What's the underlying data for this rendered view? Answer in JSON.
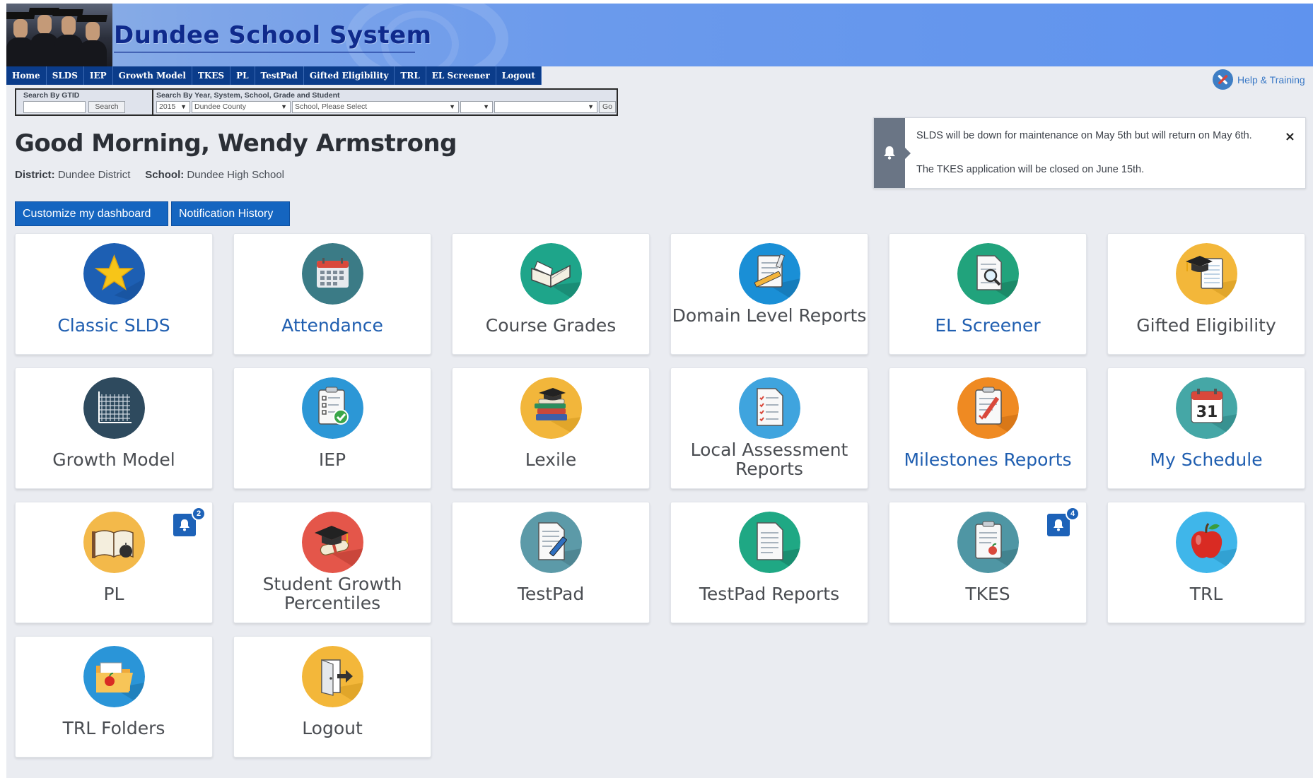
{
  "header": {
    "site_title": "Dundee School System",
    "nav": [
      "Home",
      "SLDS",
      "IEP",
      "Growth Model",
      "TKES",
      "PL",
      "TestPad",
      "Gifted Eligibility",
      "TRL",
      "EL Screener",
      "Logout"
    ],
    "help_link": "Help & Training"
  },
  "search": {
    "gtid_label": "Search By GTID",
    "gtid_value": "",
    "search_button": "Search",
    "advanced_label": "Search By Year, System, School, Grade and Student",
    "year_value": "2015",
    "system_value": "Dundee County",
    "school_value": "School, Please Select",
    "grade_value": "",
    "student_value": "",
    "go_button": "Go"
  },
  "greeting": {
    "text": "Good Morning, Wendy Armstrong",
    "district_label": "District:",
    "district_value": "Dundee District",
    "school_label": "School:",
    "school_value": "Dundee High School"
  },
  "buttons": {
    "customize": "Customize my dashboard",
    "history": "Notification History"
  },
  "notifications": {
    "messages": [
      "SLDS will be down for maintenance on May 5th but will return on May 6th.",
      "The TKES application will be closed on June 15th."
    ],
    "close": "×"
  },
  "tiles": [
    {
      "label": "Classic SLDS",
      "icon": "star-icon",
      "color": "#1f5eb0"
    },
    {
      "label": "Attendance",
      "icon": "calendar-icon",
      "color": "#1f5eb0"
    },
    {
      "label": "Course Grades",
      "icon": "open-book-icon",
      "color": "#4a4d52"
    },
    {
      "label": "Domain Level Reports",
      "icon": "report-pencil-icon",
      "color": "#4a4d52"
    },
    {
      "label": "EL Screener",
      "icon": "magnifier-document-icon",
      "color": "#1f5eb0"
    },
    {
      "label": "Gifted Eligibility",
      "icon": "graduation-notes-icon",
      "color": "#4a4d52"
    },
    {
      "label": "Growth Model",
      "icon": "grid-chart-icon",
      "color": "#4a4d52"
    },
    {
      "label": "IEP",
      "icon": "checklist-clipboard-icon",
      "color": "#4a4d52"
    },
    {
      "label": "Lexile",
      "icon": "book-stack-icon",
      "color": "#4a4d52"
    },
    {
      "label": "Local Assessment Reports",
      "icon": "checklist-document-icon",
      "color": "#4a4d52"
    },
    {
      "label": "Milestones Reports",
      "icon": "clipboard-pen-icon",
      "color": "#1f5eb0"
    },
    {
      "label": "My Schedule",
      "icon": "calendar-31-icon",
      "color": "#1f5eb0"
    },
    {
      "label": "PL",
      "icon": "book-apple-icon",
      "color": "#4a4d52",
      "badge": "2"
    },
    {
      "label": "Student Growth Percentiles",
      "icon": "diploma-cap-icon",
      "color": "#4a4d52"
    },
    {
      "label": "TestPad",
      "icon": "document-pencil-icon",
      "color": "#4a4d52"
    },
    {
      "label": "TestPad Reports",
      "icon": "document-lines-icon",
      "color": "#4a4d52"
    },
    {
      "label": "TKES",
      "icon": "clipboard-apple-icon",
      "color": "#4a4d52",
      "badge": "4"
    },
    {
      "label": "TRL",
      "icon": "apple-icon",
      "color": "#4a4d52"
    },
    {
      "label": "TRL Folders",
      "icon": "folder-apple-icon",
      "color": "#4a4d52"
    },
    {
      "label": "Logout",
      "icon": "door-exit-icon",
      "color": "#4a4d52"
    }
  ]
}
